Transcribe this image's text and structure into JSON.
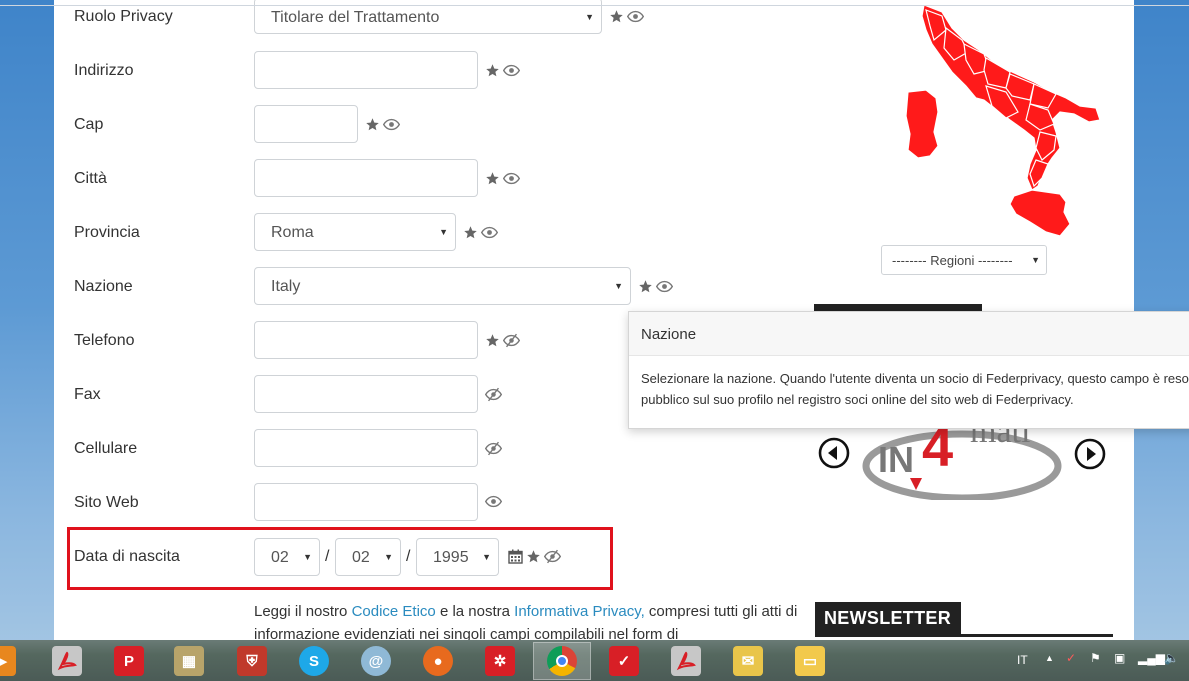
{
  "form": {
    "rows": [
      {
        "label": "Ruolo Privacy",
        "type": "select",
        "value": "Titolare del Trattamento",
        "icons": [
          "star-icon",
          "eye-icon"
        ]
      },
      {
        "label": "Indirizzo",
        "type": "input",
        "value": "",
        "icons": [
          "star-icon",
          "eye-icon"
        ]
      },
      {
        "label": "Cap",
        "type": "input",
        "value": "",
        "icons": [
          "star-icon",
          "eye-icon"
        ]
      },
      {
        "label": "Città",
        "type": "input",
        "value": "",
        "icons": [
          "star-icon",
          "eye-icon"
        ]
      },
      {
        "label": "Provincia",
        "type": "select",
        "value": "Roma",
        "icons": [
          "star-icon",
          "eye-icon"
        ]
      },
      {
        "label": "Nazione",
        "type": "select",
        "value": "Italy",
        "icons": [
          "star-icon",
          "eye-icon"
        ]
      },
      {
        "label": "Telefono",
        "type": "input",
        "value": "",
        "icons": [
          "star-icon",
          "eye-slash-icon"
        ]
      },
      {
        "label": "Fax",
        "type": "input",
        "value": "",
        "icons": [
          "eye-slash-icon"
        ]
      },
      {
        "label": "Cellulare",
        "type": "input",
        "value": "",
        "icons": [
          "eye-slash-icon"
        ]
      },
      {
        "label": "Sito Web",
        "type": "input",
        "value": "",
        "icons": [
          "eye-icon"
        ]
      }
    ],
    "birthdate": {
      "label": "Data di nascita",
      "day": "02",
      "month": "02",
      "year": "1995",
      "separator": "/",
      "icons": [
        "calendar-icon",
        "star-icon",
        "eye-slash-icon"
      ]
    },
    "highlight_color": "#e0121c"
  },
  "tooltip": {
    "title": "Nazione",
    "body": "Selezionare la nazione. Quando l'utente diventa un socio di Federprivacy, questo campo è reso pubblico sul suo profilo nel registro soci online del sito web di Federprivacy."
  },
  "legal": {
    "prefix": "Leggi il nostro ",
    "link1": "Codice Etico",
    "middle": " e la nostra ",
    "link2": "Informativa Privacy,",
    "suffix": " compresi tutti gli atti di informazione evidenziati nei singoli campi compilabili nel form di"
  },
  "sidebar": {
    "regioni_select": "-------- Regioni --------",
    "newsletter_title": "NEWSLETTER",
    "map_color": "#ff1a1a"
  },
  "taskbar": {
    "language": "IT",
    "apps": [
      "media-player-icon",
      "acrobat-icon",
      "p-app-icon",
      "archive-icon",
      "shield-icon",
      "skype-icon",
      "email-icon",
      "firefox-icon",
      "network-app-icon",
      "chrome-icon",
      "antivirus-icon",
      "acrobat-icon",
      "mail-folder-icon",
      "file-explorer-icon"
    ],
    "colors": {
      "bar": "#55685f",
      "icon_red": "#d81f26",
      "skype": "#1ea8e8"
    }
  }
}
